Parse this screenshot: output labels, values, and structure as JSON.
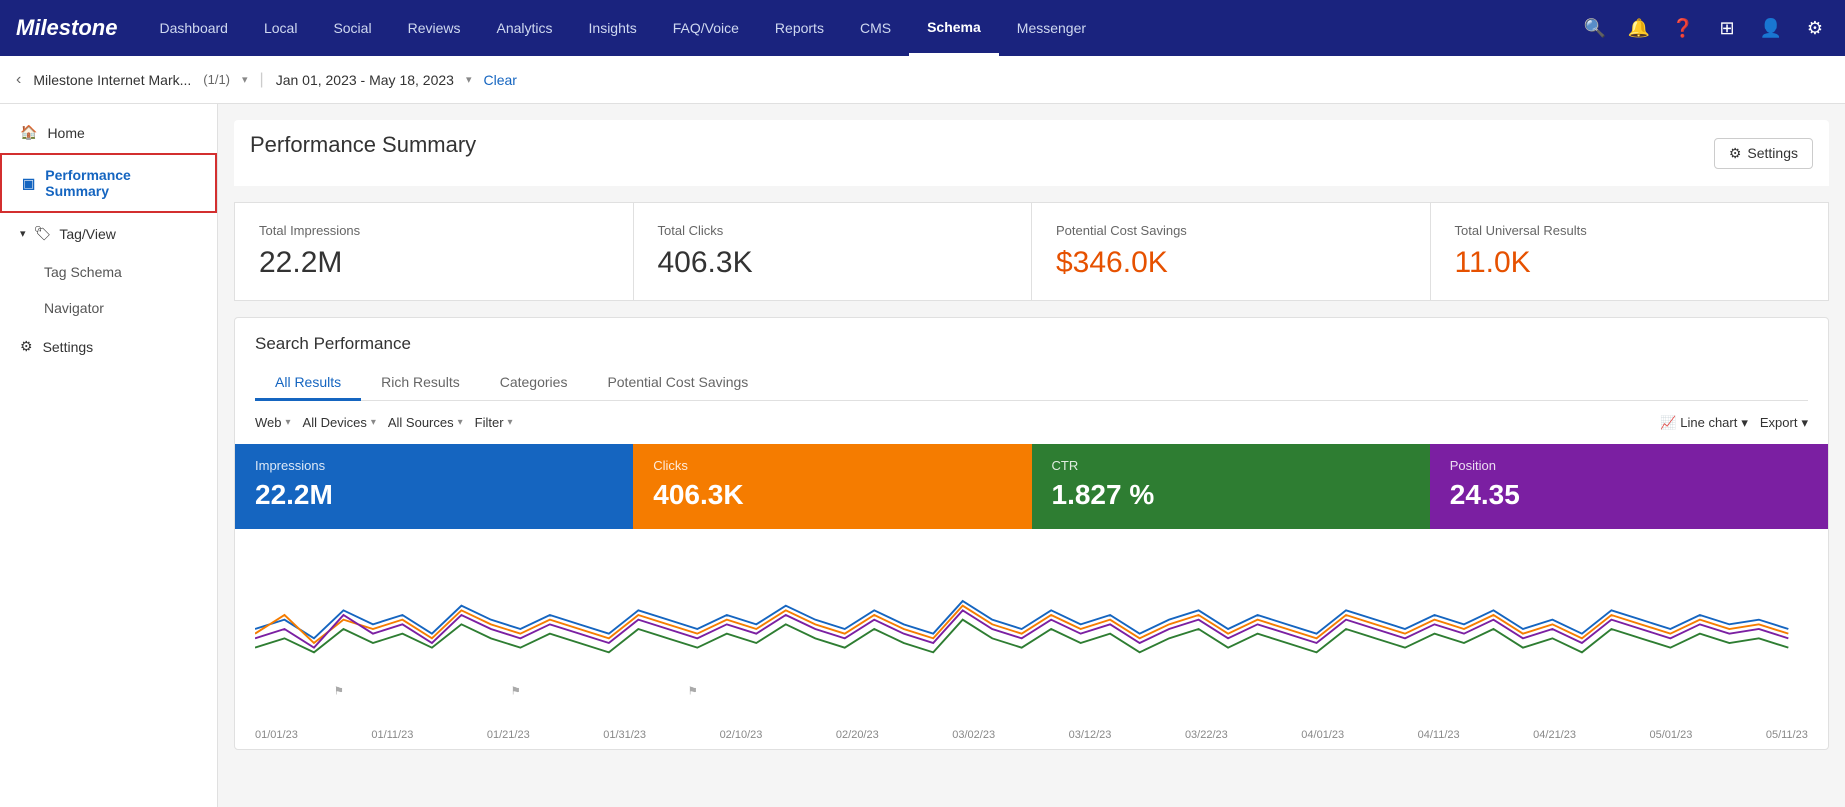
{
  "app": {
    "logo": "Milestone"
  },
  "nav": {
    "items": [
      {
        "id": "dashboard",
        "label": "Dashboard",
        "active": false
      },
      {
        "id": "local",
        "label": "Local",
        "active": false
      },
      {
        "id": "social",
        "label": "Social",
        "active": false
      },
      {
        "id": "reviews",
        "label": "Reviews",
        "active": false
      },
      {
        "id": "analytics",
        "label": "Analytics",
        "active": false
      },
      {
        "id": "insights",
        "label": "Insights",
        "active": false
      },
      {
        "id": "faq-voice",
        "label": "FAQ/Voice",
        "active": false
      },
      {
        "id": "reports",
        "label": "Reports",
        "active": false
      },
      {
        "id": "cms",
        "label": "CMS",
        "active": false
      },
      {
        "id": "schema",
        "label": "Schema",
        "active": true
      },
      {
        "id": "messenger",
        "label": "Messenger",
        "active": false
      }
    ]
  },
  "secondary_bar": {
    "site_name": "Milestone Internet Mark...",
    "site_count": "(1/1)",
    "date_range": "Jan 01, 2023 - May 18, 2023",
    "clear_label": "Clear"
  },
  "sidebar": {
    "home_label": "Home",
    "performance_summary_label": "Performance Summary",
    "tag_view_label": "Tag/View",
    "tag_schema_label": "Tag Schema",
    "navigator_label": "Navigator",
    "settings_label": "Settings"
  },
  "content": {
    "page_title": "Performance Summary",
    "settings_btn_label": "Settings",
    "metrics": [
      {
        "id": "total-impressions",
        "label": "Total Impressions",
        "value": "22.2M",
        "gold": false
      },
      {
        "id": "total-clicks",
        "label": "Total Clicks",
        "value": "406.3K",
        "gold": false
      },
      {
        "id": "potential-cost-savings",
        "label": "Potential Cost Savings",
        "value": "$346.0K",
        "gold": true
      },
      {
        "id": "total-universal-results",
        "label": "Total Universal Results",
        "value": "11.0K",
        "gold": true
      }
    ],
    "search_performance": {
      "title": "Search Performance",
      "tabs": [
        {
          "id": "all-results",
          "label": "All Results",
          "active": true
        },
        {
          "id": "rich-results",
          "label": "Rich Results",
          "active": false
        },
        {
          "id": "categories",
          "label": "Categories",
          "active": false
        },
        {
          "id": "potential-cost-savings",
          "label": "Potential Cost Savings",
          "active": false
        }
      ],
      "filters": [
        {
          "id": "web",
          "label": "Web"
        },
        {
          "id": "all-devices",
          "label": "All Devices"
        },
        {
          "id": "all-sources",
          "label": "All Sources"
        },
        {
          "id": "filter",
          "label": "Filter"
        }
      ],
      "chart_controls": [
        {
          "id": "line-chart",
          "label": "Line chart"
        },
        {
          "id": "export",
          "label": "Export"
        }
      ],
      "bands": [
        {
          "id": "impressions",
          "label": "Impressions",
          "value": "22.2M",
          "color": "band-impressions"
        },
        {
          "id": "clicks",
          "label": "Clicks",
          "value": "406.3K",
          "color": "band-clicks"
        },
        {
          "id": "ctr",
          "label": "CTR",
          "value": "1.827 %",
          "color": "band-ctr"
        },
        {
          "id": "position",
          "label": "Position",
          "value": "24.35",
          "color": "band-position"
        }
      ],
      "x_axis_labels": [
        "01/01/23",
        "01/11/23",
        "01/21/23",
        "01/31/23",
        "02/10/23",
        "02/20/23",
        "03/02/23",
        "03/12/23",
        "03/22/23",
        "04/01/23",
        "04/11/23",
        "04/21/23",
        "05/01/23",
        "05/11/23"
      ]
    }
  },
  "colors": {
    "nav_bg": "#1a237e",
    "accent_blue": "#1565c0",
    "impressions": "#1565c0",
    "clicks": "#f57c00",
    "ctr": "#2e7d32",
    "position": "#7b1fa2",
    "gold": "#e65100"
  }
}
